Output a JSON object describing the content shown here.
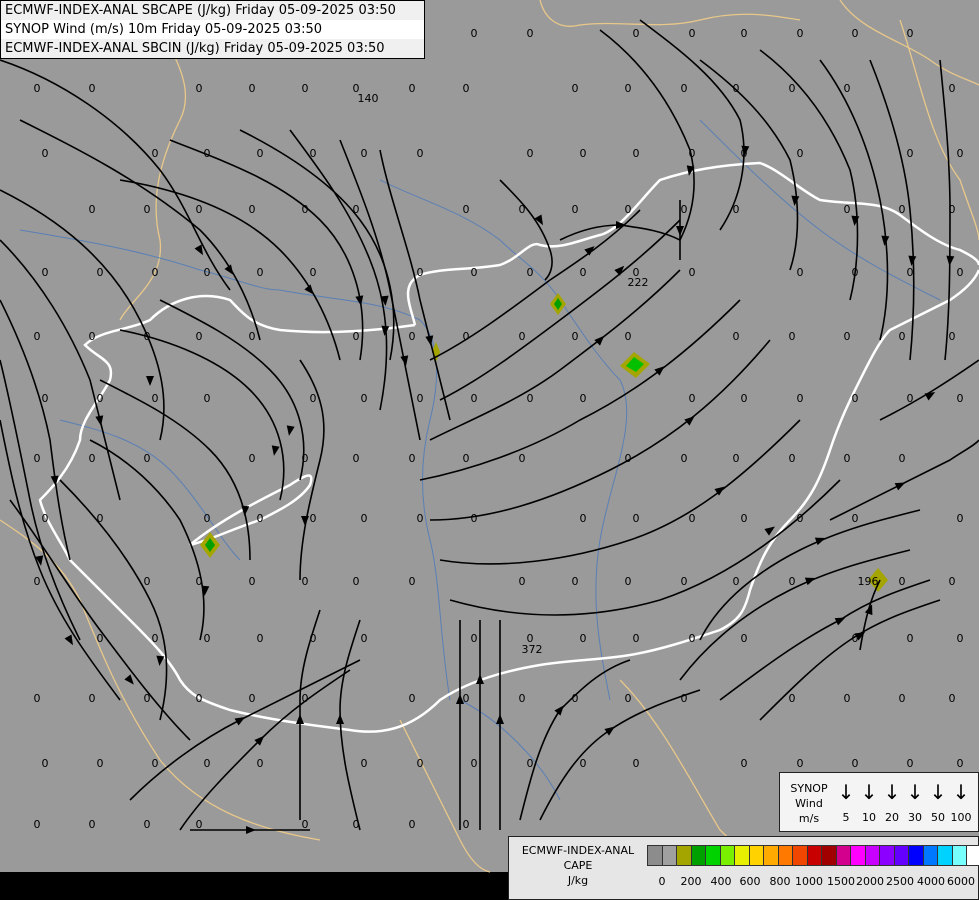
{
  "header": {
    "line1": "ECMWF-INDEX-ANAL SBCAPE (J/kg) Friday 05-09-2025 03:50",
    "line2": "SYNOP Wind (m/s) 10m Friday 05-09-2025 03:50",
    "line3": "ECMWF-INDEX-ANAL SBCIN (J/kg) Friday 05-09-2025 03:50"
  },
  "map_values": [
    "0",
    "140",
    "222",
    "196",
    "372"
  ],
  "synop_legend": {
    "title_line1": "SYNOP",
    "title_line2": "Wind",
    "title_line3": "m/s",
    "speeds": [
      "5",
      "10",
      "20",
      "30",
      "50",
      "100"
    ]
  },
  "cape_legend": {
    "title_line1": "ECMWF-INDEX-ANAL",
    "title_line2": "CAPE",
    "title_line3": "J/kg",
    "colors": [
      "#8c8c8c",
      "#a0a0a0",
      "#a5a500",
      "#00a000",
      "#00d200",
      "#78f000",
      "#e6f000",
      "#ffd200",
      "#ffaa00",
      "#ff7800",
      "#f04600",
      "#c80000",
      "#a00000",
      "#d2008c",
      "#ff00ff",
      "#c800ff",
      "#8c00ff",
      "#6400ff",
      "#0000ff",
      "#0078ff",
      "#00d2ff",
      "#78ffff",
      "#ffffff"
    ],
    "ticks": [
      "0",
      "200",
      "400",
      "600",
      "800",
      "1000",
      "1500",
      "2000",
      "2500",
      "4000",
      "6000"
    ]
  },
  "colors": {
    "map_background": "#9a9a9a",
    "border": "#ffffff",
    "coast": "#e8c88a",
    "river": "#5a7fb5",
    "streamline": "#000000"
  }
}
